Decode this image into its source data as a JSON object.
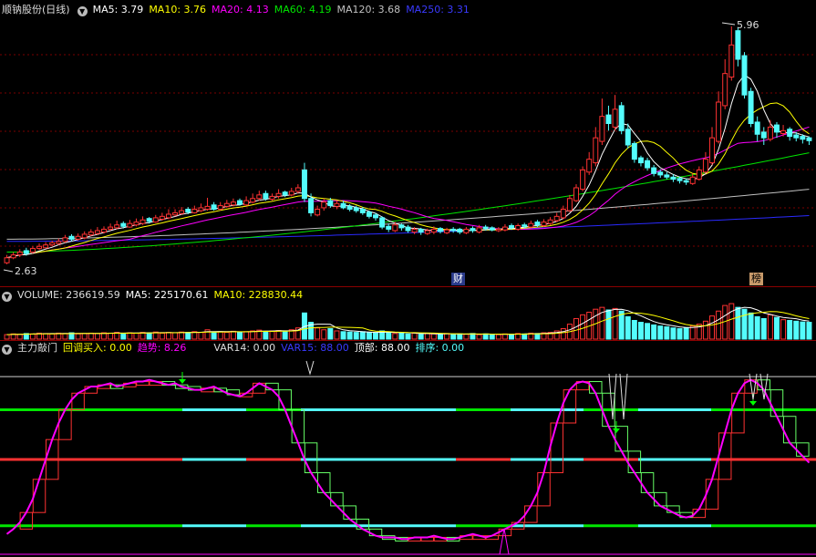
{
  "main_header": {
    "title": "顺钠股份(日线)",
    "ma5": "MA5: 3.79",
    "ma10": "MA10: 3.76",
    "ma20": "MA20: 4.13",
    "ma60": "MA60: 4.19",
    "ma120": "MA120: 3.68",
    "ma250": "MA250: 3.31"
  },
  "price_labels": {
    "high": "5.96",
    "low": "2.63"
  },
  "markers": {
    "cai": "财",
    "bang": "榜"
  },
  "volume_header": {
    "vol": "VOLUME: 236619.59",
    "ma5": "MA5: 225170.61",
    "ma10": "MA10: 228830.44"
  },
  "ind_header": {
    "name": "主力敲门",
    "huitiao": "回调买入: 0.00",
    "qushi": "趋势: 8.26",
    "var14": "VAR14: 0.00",
    "var15": "VAR15: 88.00",
    "dingbu": "顶部: 88.00",
    "paixu": "排序: 0.00"
  },
  "colors": {
    "up": "#ff3232",
    "down": "#54fcfc",
    "ma5": "#ffffff",
    "ma10": "#ffff00",
    "ma20": "#ff00ff",
    "ma60": "#00e600",
    "ma120": "#c0c0c0",
    "ma250": "#2a2aff",
    "trend": "#ff00ff",
    "box_up": "#ff3232",
    "box_down": "#66ff66"
  },
  "chart_data": [
    {
      "type": "candlestick",
      "title": "顺钠股份(日线)",
      "ylim": [
        2.5,
        6.1
      ],
      "close": [
        2.72,
        2.76,
        2.8,
        2.78,
        2.85,
        2.88,
        2.9,
        2.93,
        2.95,
        3.0,
        2.98,
        3.02,
        3.05,
        3.08,
        3.1,
        3.12,
        3.15,
        3.18,
        3.16,
        3.2,
        3.22,
        3.25,
        3.23,
        3.28,
        3.3,
        3.33,
        3.35,
        3.38,
        3.36,
        3.4,
        3.42,
        3.44,
        3.4,
        3.45,
        3.48,
        3.5,
        3.47,
        3.52,
        3.55,
        3.6,
        3.55,
        3.58,
        3.62,
        3.6,
        3.65,
        3.7,
        3.55,
        3.35,
        3.4,
        3.5,
        3.45,
        3.48,
        3.42,
        3.4,
        3.38,
        3.35,
        3.3,
        3.28,
        3.15,
        3.12,
        3.18,
        3.14,
        3.1,
        3.12,
        3.08,
        3.1,
        3.12,
        3.09,
        3.11,
        3.1,
        3.08,
        3.12,
        3.1,
        3.14,
        3.13,
        3.11,
        3.12,
        3.15,
        3.14,
        3.17,
        3.16,
        3.2,
        3.18,
        3.22,
        3.25,
        3.3,
        3.4,
        3.55,
        3.7,
        3.95,
        4.1,
        4.4,
        4.7,
        4.6,
        4.8,
        4.5,
        4.3,
        4.1,
        4.05,
        3.98,
        3.9,
        3.88,
        3.85,
        3.82,
        3.8,
        3.78,
        3.85,
        3.95,
        4.1,
        4.4,
        4.9,
        5.3,
        5.7,
        5.5,
        5.0,
        4.6,
        4.45,
        4.4,
        4.55,
        4.48,
        4.5,
        4.42,
        4.4,
        4.38,
        4.36
      ],
      "open": [
        2.65,
        2.72,
        2.76,
        2.82,
        2.8,
        2.85,
        2.86,
        2.9,
        2.92,
        2.95,
        3.02,
        2.98,
        3.0,
        3.04,
        3.06,
        3.08,
        3.12,
        3.14,
        3.2,
        3.15,
        3.18,
        3.2,
        3.27,
        3.22,
        3.26,
        3.28,
        3.32,
        3.34,
        3.4,
        3.35,
        3.38,
        3.4,
        3.46,
        3.4,
        3.44,
        3.46,
        3.52,
        3.46,
        3.5,
        3.55,
        3.62,
        3.54,
        3.58,
        3.64,
        3.6,
        3.65,
        3.95,
        3.55,
        3.32,
        3.42,
        3.52,
        3.44,
        3.48,
        3.44,
        3.42,
        3.4,
        3.36,
        3.32,
        3.28,
        3.16,
        3.1,
        3.18,
        3.15,
        3.08,
        3.12,
        3.06,
        3.08,
        3.13,
        3.07,
        3.12,
        3.12,
        3.07,
        3.13,
        3.08,
        3.15,
        3.14,
        3.1,
        3.11,
        3.17,
        3.12,
        3.18,
        3.15,
        3.22,
        3.17,
        3.2,
        3.24,
        3.28,
        3.38,
        3.52,
        3.68,
        3.92,
        4.05,
        4.35,
        4.72,
        4.55,
        4.85,
        4.52,
        4.32,
        4.12,
        4.08,
        3.98,
        3.92,
        3.88,
        3.85,
        3.83,
        3.8,
        3.76,
        3.82,
        3.92,
        4.05,
        4.35,
        4.85,
        5.25,
        5.9,
        5.55,
        5.05,
        4.62,
        4.48,
        4.38,
        4.58,
        4.46,
        4.52,
        4.44,
        4.42,
        4.4
      ],
      "high": [
        2.76,
        2.8,
        2.84,
        2.86,
        2.88,
        2.92,
        2.94,
        2.96,
        2.99,
        3.04,
        3.05,
        3.06,
        3.09,
        3.12,
        3.15,
        3.16,
        3.2,
        3.24,
        3.23,
        3.25,
        3.27,
        3.3,
        3.29,
        3.32,
        3.35,
        3.4,
        3.4,
        3.43,
        3.43,
        3.45,
        3.48,
        3.56,
        3.5,
        3.5,
        3.53,
        3.55,
        3.55,
        3.58,
        3.62,
        3.66,
        3.66,
        3.62,
        3.68,
        3.66,
        3.7,
        3.75,
        4.05,
        3.62,
        3.45,
        3.55,
        3.56,
        3.52,
        3.52,
        3.47,
        3.45,
        3.43,
        3.38,
        3.35,
        3.3,
        3.2,
        3.22,
        3.2,
        3.18,
        3.15,
        3.14,
        3.13,
        3.16,
        3.15,
        3.14,
        3.15,
        3.14,
        3.15,
        3.16,
        3.18,
        3.18,
        3.16,
        3.15,
        3.19,
        3.2,
        3.2,
        3.21,
        3.24,
        3.25,
        3.26,
        3.29,
        3.35,
        3.45,
        3.6,
        3.75,
        4.0,
        4.2,
        4.55,
        4.95,
        4.85,
        5.0,
        4.9,
        4.6,
        4.35,
        4.15,
        4.12,
        4.02,
        3.96,
        3.92,
        3.89,
        3.86,
        3.83,
        3.9,
        4.0,
        4.2,
        4.55,
        5.05,
        5.5,
        5.96,
        5.95,
        5.6,
        5.1,
        4.7,
        4.55,
        4.65,
        4.62,
        4.58,
        4.55,
        4.48,
        4.45,
        4.42
      ],
      "low": [
        2.63,
        2.7,
        2.73,
        2.75,
        2.78,
        2.83,
        2.85,
        2.88,
        2.9,
        2.93,
        2.95,
        2.96,
        2.98,
        3.02,
        3.04,
        3.06,
        3.1,
        3.12,
        3.13,
        3.14,
        3.16,
        3.18,
        3.2,
        3.21,
        3.24,
        3.26,
        3.3,
        3.32,
        3.33,
        3.34,
        3.36,
        3.38,
        3.38,
        3.38,
        3.42,
        3.44,
        3.45,
        3.45,
        3.48,
        3.52,
        3.52,
        3.52,
        3.55,
        3.57,
        3.58,
        3.62,
        3.5,
        3.3,
        3.3,
        3.38,
        3.42,
        3.4,
        3.4,
        3.37,
        3.35,
        3.32,
        3.27,
        3.24,
        3.12,
        3.08,
        3.08,
        3.1,
        3.07,
        3.05,
        3.04,
        3.04,
        3.05,
        3.06,
        3.05,
        3.07,
        3.05,
        3.05,
        3.07,
        3.06,
        3.1,
        3.09,
        3.08,
        3.09,
        3.11,
        3.1,
        3.13,
        3.13,
        3.15,
        3.15,
        3.18,
        3.22,
        3.26,
        3.36,
        3.5,
        3.65,
        3.88,
        4.0,
        4.3,
        4.5,
        4.5,
        4.45,
        4.25,
        4.05,
        4.0,
        3.94,
        3.86,
        3.84,
        3.82,
        3.78,
        3.76,
        3.74,
        3.74,
        3.8,
        3.9,
        4.02,
        4.32,
        4.8,
        5.2,
        5.4,
        4.95,
        4.55,
        4.35,
        4.3,
        4.35,
        4.4,
        4.42,
        4.36,
        4.35,
        4.32,
        4.3
      ],
      "ma250_start": 2.95,
      "ma250_end": 3.31,
      "ma120_start": 2.98,
      "ma120_end": 3.68,
      "ma60_start": 2.8,
      "ma60_end": 4.19
    },
    {
      "type": "bar",
      "title": "VOLUME",
      "values": [
        12,
        14,
        13,
        15,
        14,
        16,
        15,
        14,
        16,
        15,
        17,
        14,
        15,
        16,
        15,
        17,
        16,
        18,
        15,
        17,
        16,
        18,
        17,
        19,
        16,
        18,
        17,
        19,
        18,
        20,
        18,
        25,
        19,
        20,
        18,
        21,
        19,
        20,
        22,
        24,
        21,
        22,
        23,
        21,
        25,
        30,
        70,
        45,
        30,
        25,
        28,
        22,
        20,
        19,
        18,
        20,
        17,
        16,
        22,
        18,
        15,
        17,
        14,
        16,
        13,
        15,
        14,
        13,
        15,
        12,
        14,
        13,
        15,
        12,
        14,
        13,
        12,
        14,
        13,
        15,
        14,
        16,
        15,
        17,
        18,
        22,
        28,
        40,
        55,
        65,
        72,
        80,
        85,
        78,
        82,
        75,
        60,
        50,
        45,
        42,
        38,
        35,
        33,
        30,
        28,
        30,
        35,
        40,
        48,
        62,
        75,
        90,
        95,
        85,
        80,
        70,
        60,
        55,
        65,
        58,
        52,
        50,
        48,
        46,
        45
      ],
      "ylim": [
        0,
        100
      ]
    },
    {
      "type": "line",
      "title": "主力敲门",
      "series": [
        {
          "name": "趋势",
          "values": [
            5,
            8,
            12,
            18,
            26,
            38,
            50,
            62,
            72,
            80,
            86,
            90,
            92,
            94,
            94,
            95,
            96,
            94,
            95,
            96,
            97,
            97,
            98,
            97,
            96,
            95,
            96,
            94,
            93,
            92,
            92,
            93,
            94,
            92,
            90,
            89,
            88,
            90,
            93,
            96,
            94,
            92,
            88,
            80,
            70,
            60,
            50,
            42,
            36,
            30,
            26,
            22,
            18,
            14,
            11,
            8,
            6,
            4,
            3,
            3,
            3,
            2,
            2,
            3,
            3,
            3,
            4,
            3,
            2,
            2,
            3,
            4,
            5,
            4,
            3,
            4,
            6,
            8,
            10,
            12,
            16,
            22,
            30,
            42,
            58,
            72,
            84,
            92,
            96,
            97,
            96,
            90,
            80,
            70,
            62,
            55,
            48,
            42,
            36,
            30,
            26,
            22,
            20,
            18,
            16,
            15,
            16,
            20,
            28,
            38,
            52,
            66,
            80,
            90,
            96,
            98,
            96,
            92,
            84,
            76,
            68,
            60,
            56,
            52,
            48
          ]
        }
      ],
      "ylim": [
        -5,
        105
      ]
    }
  ]
}
